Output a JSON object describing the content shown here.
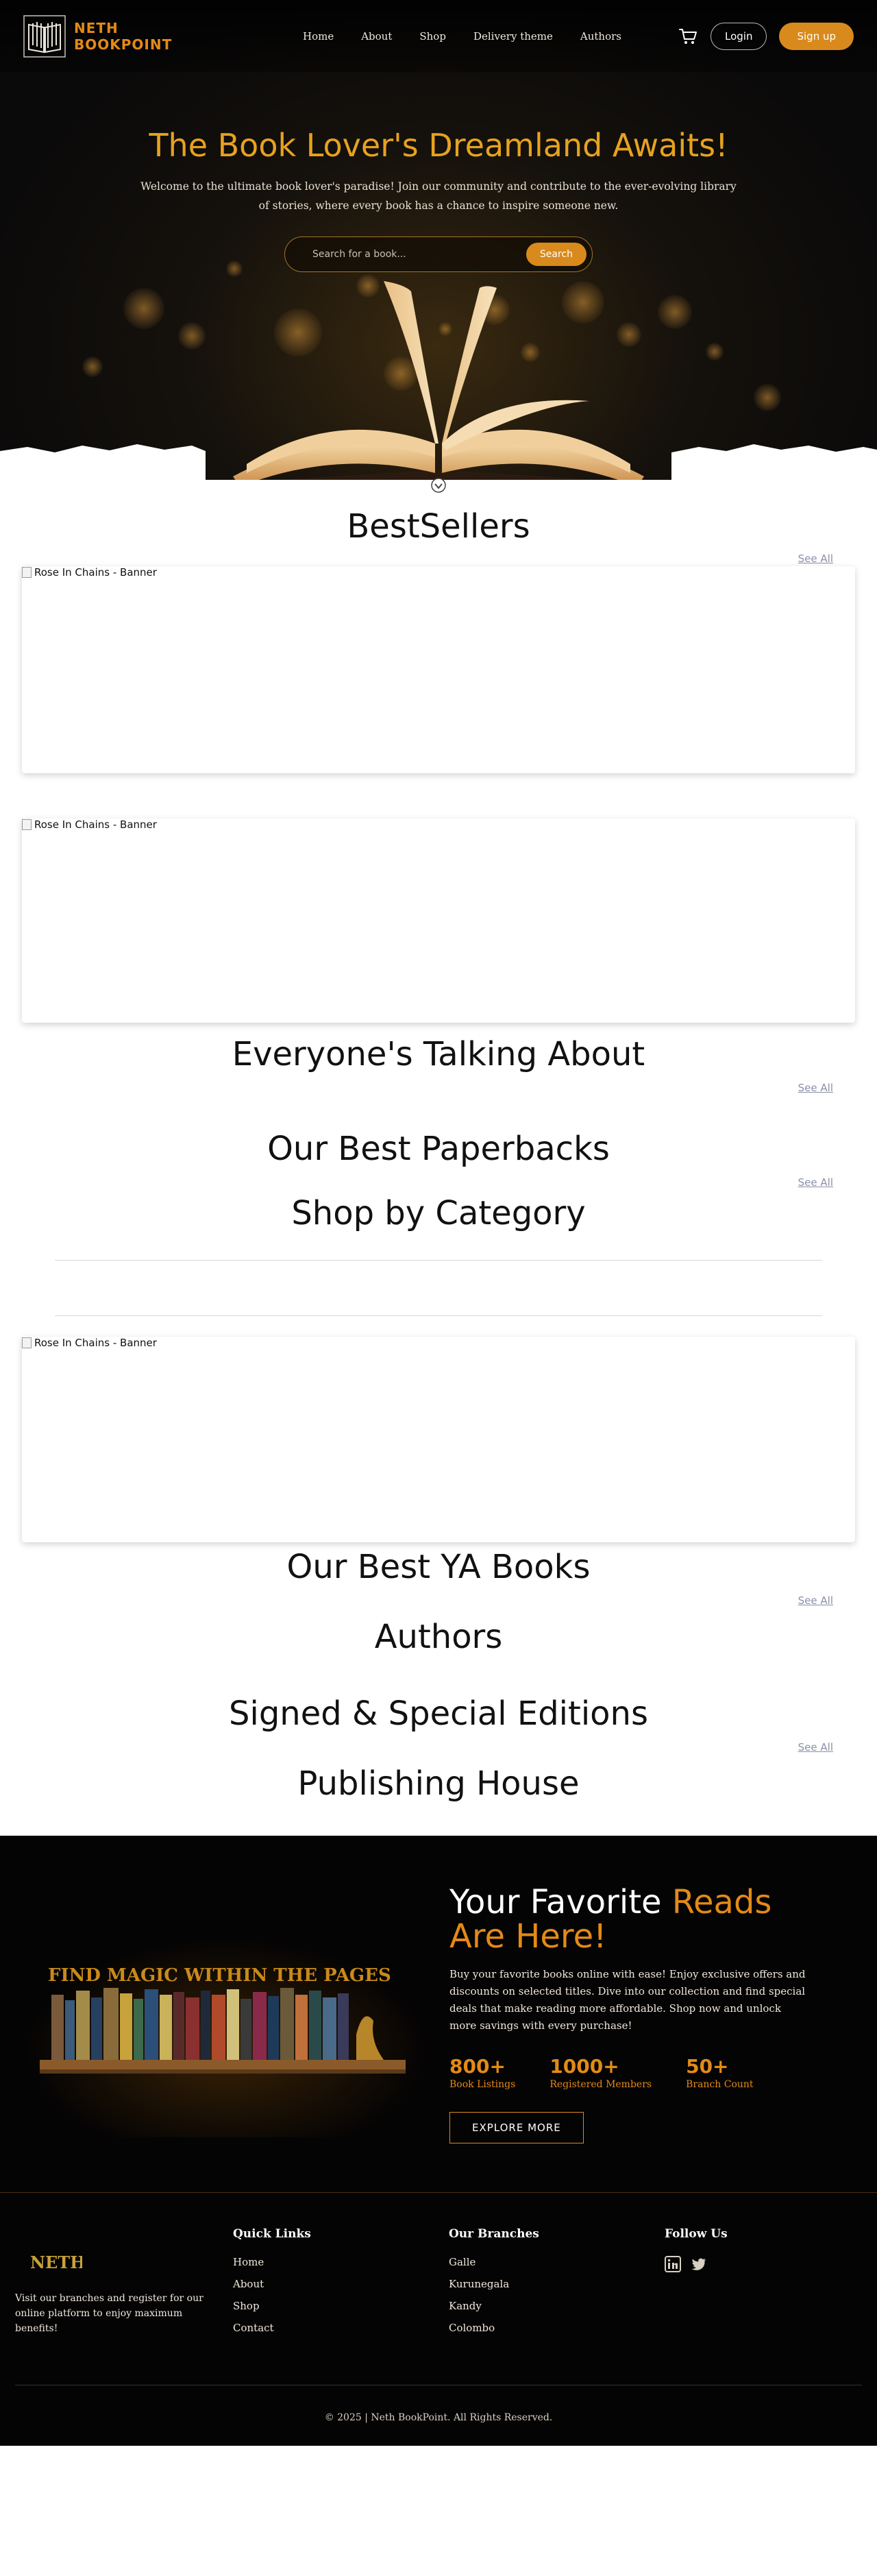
{
  "brand": {
    "name_line1": "NETH",
    "name_line2": "BOOKPOINT",
    "accent": "#e38a17"
  },
  "nav": {
    "links": [
      "Home",
      "About",
      "Shop",
      "Delivery theme",
      "Authors"
    ],
    "login": "Login",
    "signup": "Sign up",
    "cart_icon": "cart-icon"
  },
  "hero": {
    "title": "The Book Lover's Dreamland Awaits!",
    "subtitle": "Welcome to the ultimate book lover's paradise! Join our community and contribute to the ever-evolving library of stories, where every book has a chance to inspire someone new.",
    "search_placeholder": "Search for a book...",
    "search_button": "Search"
  },
  "sections": {
    "bestsellers": {
      "title": "BestSellers",
      "see_all": "See All"
    },
    "banner_alt": "Rose In Chains - Banner",
    "talking": {
      "title": "Everyone's Talking About",
      "see_all": "See All"
    },
    "paperbacks": {
      "title": "Our Best Paperbacks",
      "see_all": "See All"
    },
    "category": {
      "title": "Shop by Category"
    },
    "ya": {
      "title": "Our Best YA Books",
      "see_all": "See All"
    },
    "authors": {
      "title": "Authors"
    },
    "signed": {
      "title": "Signed & Special Editions",
      "see_all": "See All"
    },
    "publishing": {
      "title": "Publishing House"
    }
  },
  "promo": {
    "image_text": "FIND MAGIC WITHIN THE PAGES",
    "heading_plain": "Your Favorite ",
    "heading_accent": "Reads Are Here!",
    "body": "Buy your favorite books online with ease! Enjoy exclusive offers and discounts on selected titles. Dive into our collection and find special deals that make reading more affordable. Shop now and unlock more savings with every purchase!",
    "stats": [
      {
        "value": "800+",
        "label": "Book Listings"
      },
      {
        "value": "1000+",
        "label": "Registered Members"
      },
      {
        "value": "50+",
        "label": "Branch Count"
      }
    ],
    "cta": "EXPLORE MORE"
  },
  "footer": {
    "logo_text": "NETH",
    "about": "Visit our branches and register for our online platform to enjoy maximum benefits!",
    "quick_links": {
      "title": "Quick Links",
      "items": [
        "Home",
        "About",
        "Shop",
        "Contact"
      ]
    },
    "branches": {
      "title": "Our Branches",
      "items": [
        "Galle",
        "Kurunegala",
        "Kandy",
        "Colombo"
      ]
    },
    "follow": {
      "title": "Follow Us",
      "icons": [
        "linkedin-icon",
        "twitter-icon"
      ]
    },
    "copyright": "© 2025 | Neth BookPoint. All Rights Reserved."
  }
}
